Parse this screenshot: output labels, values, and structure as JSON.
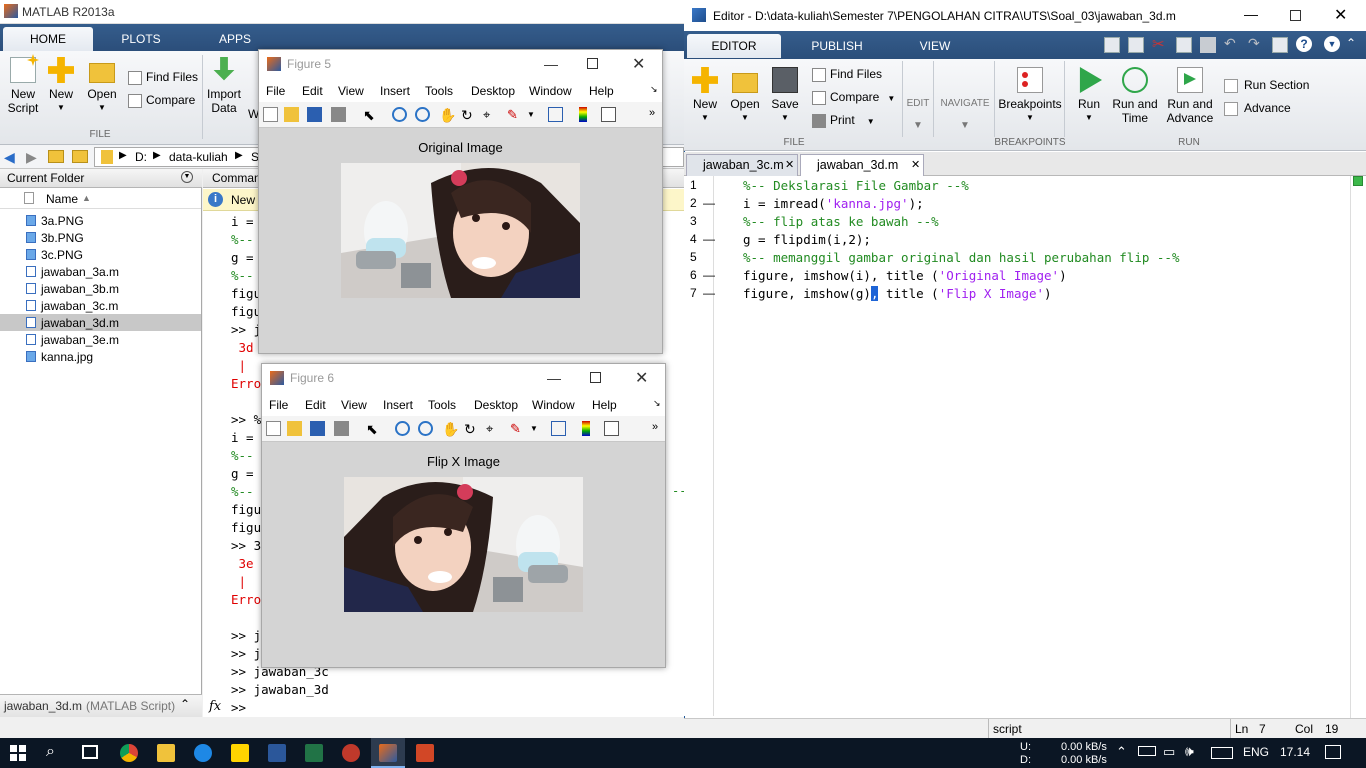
{
  "matlab": {
    "title": "MATLAB R2013a",
    "tabs": [
      "HOME",
      "PLOTS",
      "APPS"
    ],
    "ribbon": {
      "new_script": "New\nScript",
      "new": "New",
      "open": "Open",
      "find_files": "Find Files",
      "compare": "Compare",
      "import_data": "Import\nData",
      "w": "W",
      "group_file": "FILE"
    },
    "address": {
      "drive": "D:",
      "folder": "data-kuliah",
      "next": "Se"
    },
    "current_folder": {
      "title": "Current Folder",
      "name_col": "Name",
      "files": [
        "3a.PNG",
        "3b.PNG",
        "3c.PNG",
        "jawaban_3a.m",
        "jawaban_3b.m",
        "jawaban_3c.m",
        "jawaban_3d.m",
        "jawaban_3e.m",
        "kanna.jpg"
      ],
      "selected_index": 6,
      "footer_name": "jawaban_3d.m",
      "footer_type": "(MATLAB Script)"
    },
    "command_window": {
      "title": "Comman",
      "notice": "New",
      "lines": [
        {
          "text": "i =",
          "cls": ""
        },
        {
          "text": "%--",
          "cls": "green"
        },
        {
          "text": "g =",
          "cls": ""
        },
        {
          "text": "%--",
          "cls": "green"
        },
        {
          "text": "figu",
          "cls": ""
        },
        {
          "text": "figu",
          "cls": ""
        },
        {
          "text": ">> j",
          "cls": ""
        },
        {
          "text": " 3d",
          "cls": "red"
        },
        {
          "text": " |",
          "cls": "red"
        },
        {
          "text": "Erro",
          "cls": "red"
        },
        {
          "text": "",
          "cls": ""
        },
        {
          "text": ">> %",
          "cls": ""
        },
        {
          "text": "i =",
          "cls": ""
        },
        {
          "text": "%--",
          "cls": "green"
        },
        {
          "text": "g =",
          "cls": ""
        },
        {
          "text": "%--",
          "cls": "green"
        },
        {
          "text": "figu",
          "cls": ""
        },
        {
          "text": "figu",
          "cls": ""
        },
        {
          "text": ">> 3",
          "cls": ""
        },
        {
          "text": " 3e",
          "cls": "red"
        },
        {
          "text": " |",
          "cls": "red"
        },
        {
          "text": "Erro",
          "cls": "red"
        },
        {
          "text": "",
          "cls": ""
        },
        {
          "text": ">> j",
          "cls": ""
        },
        {
          "text": ">> j",
          "cls": ""
        },
        {
          "text": ">> jawaban_3c",
          "cls": ""
        },
        {
          "text": ">> jawaban_3d",
          "cls": ""
        }
      ],
      "prompt": ">>",
      "fx": "fx",
      "right_dash": "--"
    }
  },
  "figure5": {
    "title": "Figure 5",
    "menu": [
      "File",
      "Edit",
      "View",
      "Insert",
      "Tools",
      "Desktop",
      "Window",
      "Help"
    ],
    "image_title": "Original Image"
  },
  "figure6": {
    "title": "Figure 6",
    "menu": [
      "File",
      "Edit",
      "View",
      "Insert",
      "Tools",
      "Desktop",
      "Window",
      "Help"
    ],
    "image_title": "Flip X Image"
  },
  "editor": {
    "title": "Editor - D:\\data-kuliah\\Semester 7\\PENGOLAHAN CITRA\\UTS\\Soal_03\\jawaban_3d.m",
    "tabs": [
      "EDITOR",
      "PUBLISH",
      "VIEW"
    ],
    "ribbon": {
      "new": "New",
      "open": "Open",
      "save": "Save",
      "find_files": "Find Files",
      "compare": "Compare",
      "print": "Print",
      "edit": "EDIT",
      "navigate": "NAVIGATE",
      "breakpoints": "Breakpoints",
      "run": "Run",
      "run_and_time": "Run and\nTime",
      "run_and_advance": "Run and\nAdvance",
      "run_section": "Run Section",
      "advance": "Advance",
      "group_file": "FILE",
      "group_breakpoints": "BREAKPOINTS",
      "group_run": "RUN"
    },
    "doc_tabs": [
      "jawaban_3c.m",
      "jawaban_3d.m"
    ],
    "code_lines": [
      {
        "num": "1",
        "dash": "",
        "html": "<span class='green'>%-- Dekslarasi File Gambar --%</span>"
      },
      {
        "num": "2",
        "dash": "—",
        "html": "i = imread(<span class='purple'>'kanna.jpg'</span>);"
      },
      {
        "num": "3",
        "dash": "",
        "html": "<span class='green'>%-- flip atas ke bawah --%</span>"
      },
      {
        "num": "4",
        "dash": "—",
        "html": "g = flipdim(i,2);"
      },
      {
        "num": "5",
        "dash": "",
        "html": "<span class='green'>%-- memanggil gambar original dan hasil perubahan flip --%</span>"
      },
      {
        "num": "6",
        "dash": "—",
        "html": "figure, imshow(i), title (<span class='purple'>'Original Image'</span>)"
      },
      {
        "num": "7",
        "dash": "—",
        "html": "figure, imshow(g)<span style='background:#1e64d6;color:#fff'>,</span> title (<span class='purple'>'Flip X Image'</span>)"
      }
    ],
    "status": {
      "type": "script",
      "ln_label": "Ln",
      "ln": "7",
      "col_label": "Col",
      "col": "19"
    }
  },
  "taskbar": {
    "net_u_label": "U:",
    "net_u": "0.00 kB/s",
    "net_d_label": "D:",
    "net_d": "0.00 kB/s",
    "lang": "ENG",
    "time": "17.14"
  }
}
